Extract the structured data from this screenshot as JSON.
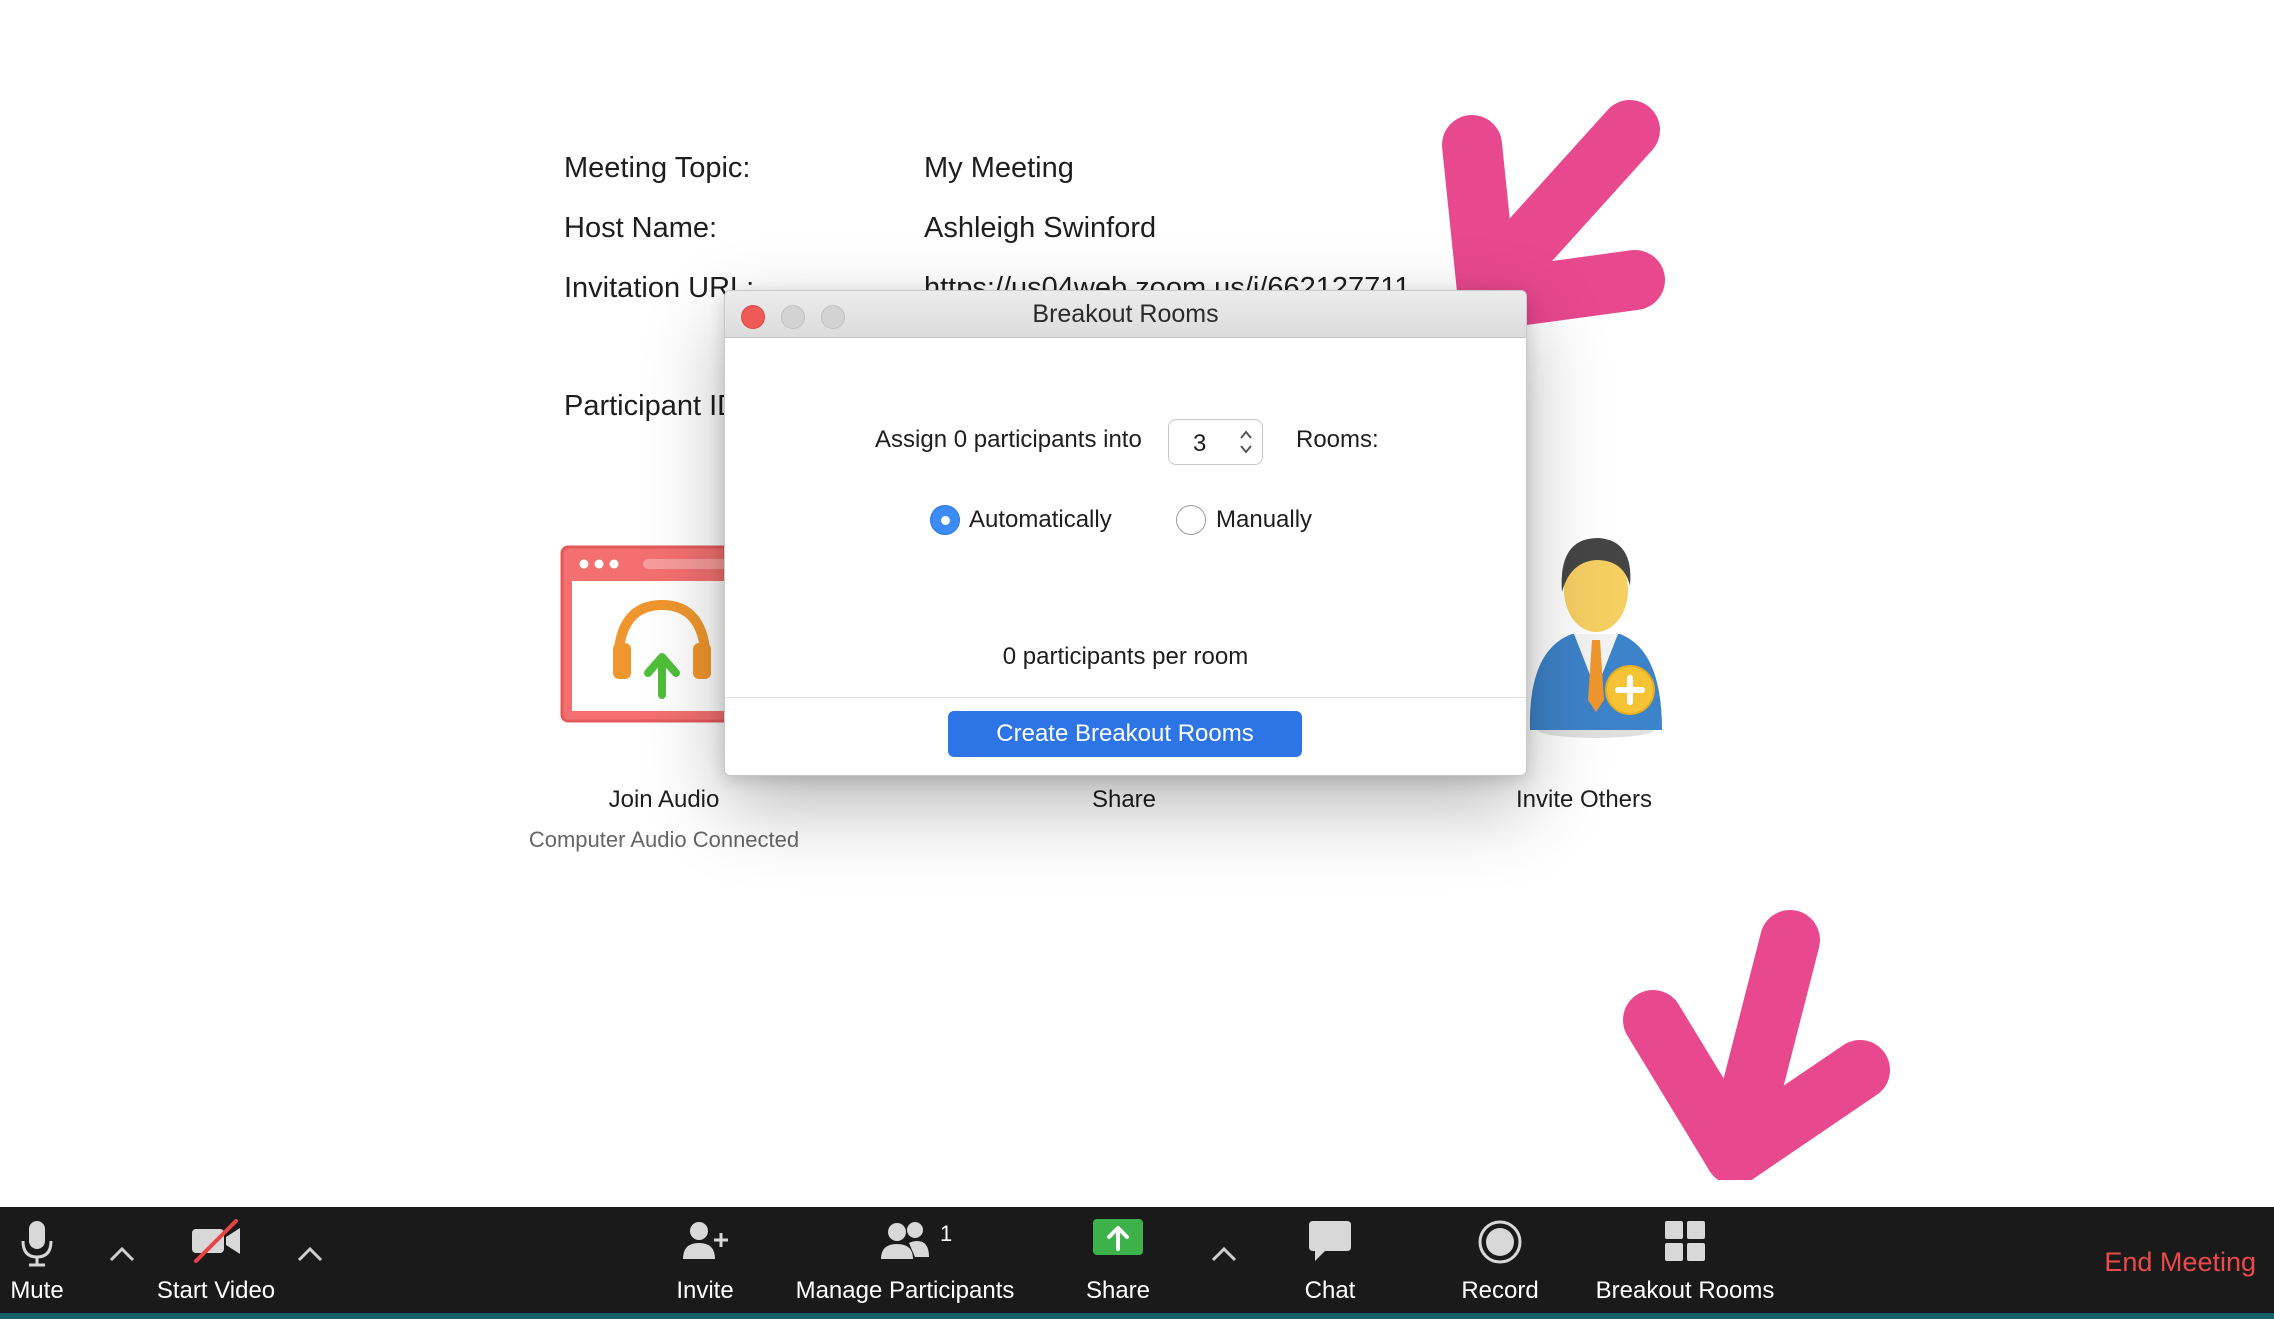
{
  "meeting_info": {
    "topic_label": "Meeting Topic:",
    "topic_value": "My Meeting",
    "host_label": "Host Name:",
    "host_value": "Ashleigh Swinford",
    "url_label": "Invitation URL:",
    "url_value": "https://us04web.zoom.us/j/662127711",
    "participant_label": "Participant ID:"
  },
  "tiles": {
    "join_audio_label": "Join Audio",
    "join_audio_sub": "Computer Audio Connected",
    "share_label": "Share",
    "invite_label": "Invite Others"
  },
  "modal": {
    "title": "Breakout Rooms",
    "assign_label": "Assign 0 participants into",
    "rooms_count": "3",
    "rooms_label": "Rooms:",
    "option_auto": "Automatically",
    "option_manual": "Manually",
    "selected_option": "Automatically",
    "per_room_text": "0 participants per room",
    "create_button": "Create Breakout Rooms"
  },
  "toolbar": {
    "mute": "Mute",
    "start_video": "Start Video",
    "invite": "Invite",
    "manage_participants": "Manage Participants",
    "participant_count": "1",
    "share": "Share",
    "chat": "Chat",
    "record": "Record",
    "breakout_rooms": "Breakout Rooms",
    "end_meeting": "End Meeting"
  },
  "colors": {
    "arrow_annotation": "#e8488e",
    "accent_blue": "#2d75e6",
    "end_meeting_red": "#ec4a4a",
    "share_green": "#3db24a",
    "toolbar_bg": "#1a1a1a"
  },
  "icons": {
    "annotation_arrows": "pink-arrow-icon",
    "join_audio": "headphones-upload-icon",
    "invite_others": "person-add-icon"
  }
}
